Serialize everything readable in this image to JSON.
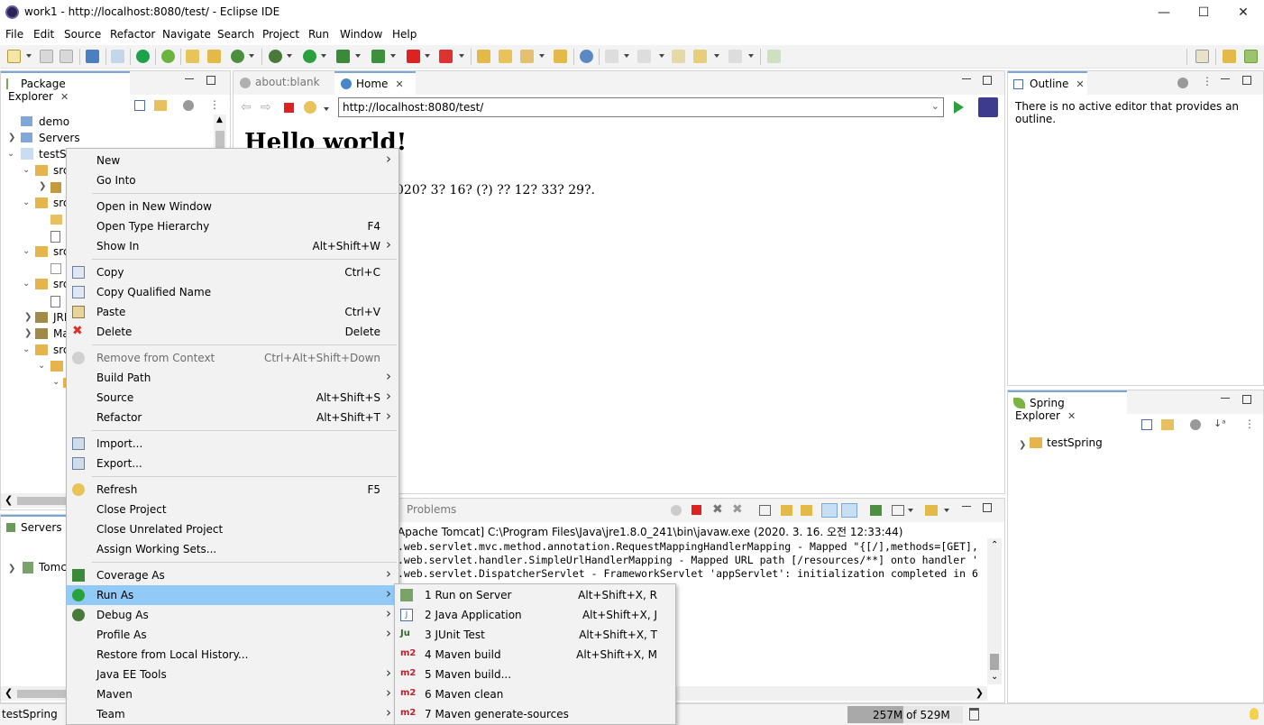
{
  "window": {
    "title": "work1 - http://localhost:8080/test/ - Eclipse IDE",
    "minimize": "—",
    "maximize": "☐",
    "close": "✕"
  },
  "menubar": [
    "File",
    "Edit",
    "Source",
    "Refactor",
    "Navigate",
    "Search",
    "Project",
    "Run",
    "Window",
    "Help"
  ],
  "package_explorer": {
    "tab": "Package Explorer",
    "items": [
      "demo",
      "Servers",
      "testSp",
      "src",
      "src",
      "src",
      "src",
      "JRE",
      "Ma",
      "src"
    ]
  },
  "servers": {
    "tab": "Servers",
    "item": "Tomc"
  },
  "browser": {
    "tab_blank": "about:blank",
    "tab_home": "Home",
    "url": "http://localhost:8080/test/",
    "heading": "Hello world!",
    "text": "020? 3? 16? (?) ?? 12? 33? 29?."
  },
  "outline": {
    "tab": "Outline",
    "message": "There is no active editor that provides an outline."
  },
  "spring_explorer": {
    "tab": "Spring Explorer",
    "item": "testSpring"
  },
  "console": {
    "tab": "Problems",
    "launch": "Apache Tomcat] C:\\Program Files\\Java\\jre1.8.0_241\\bin\\javaw.exe (2020. 3. 16. 오전 12:33:44)",
    "lines": [
      ".web.servlet.mvc.method.annotation.RequestMappingHandlerMapping - Mapped \"{[/],methods=[GET],",
      ".web.servlet.handler.SimpleUrlHandlerMapping - Mapped URL path [/resources/**] onto handler '",
      ".web.servlet.DispatcherServlet - FrameworkServlet 'appServlet': initialization completed in 6"
    ]
  },
  "context_menu": {
    "groups": [
      [
        {
          "label": "New",
          "shortcut": "",
          "submenu": true
        },
        {
          "label": "Go Into",
          "shortcut": "",
          "submenu": false
        }
      ],
      [
        {
          "label": "Open in New Window",
          "shortcut": "",
          "submenu": false
        },
        {
          "label": "Open Type Hierarchy",
          "shortcut": "F4",
          "submenu": false
        },
        {
          "label": "Show In",
          "shortcut": "Alt+Shift+W",
          "submenu": true
        }
      ],
      [
        {
          "label": "Copy",
          "shortcut": "Ctrl+C",
          "submenu": false,
          "icon": "copy-icon"
        },
        {
          "label": "Copy Qualified Name",
          "shortcut": "",
          "submenu": false,
          "icon": "copy-qualified-icon"
        },
        {
          "label": "Paste",
          "shortcut": "Ctrl+V",
          "submenu": false,
          "icon": "paste-icon"
        },
        {
          "label": "Delete",
          "shortcut": "Delete",
          "submenu": false,
          "icon": "delete-icon"
        }
      ],
      [
        {
          "label": "Remove from Context",
          "shortcut": "Ctrl+Alt+Shift+Down",
          "submenu": false,
          "disabled": true,
          "icon": "remove-context-icon"
        },
        {
          "label": "Build Path",
          "shortcut": "",
          "submenu": true
        },
        {
          "label": "Source",
          "shortcut": "Alt+Shift+S",
          "submenu": true
        },
        {
          "label": "Refactor",
          "shortcut": "Alt+Shift+T",
          "submenu": true
        }
      ],
      [
        {
          "label": "Import...",
          "shortcut": "",
          "submenu": false,
          "icon": "import-icon"
        },
        {
          "label": "Export...",
          "shortcut": "",
          "submenu": false,
          "icon": "export-icon"
        }
      ],
      [
        {
          "label": "Refresh",
          "shortcut": "F5",
          "submenu": false,
          "icon": "refresh-icon"
        },
        {
          "label": "Close Project",
          "shortcut": "",
          "submenu": false
        },
        {
          "label": "Close Unrelated Project",
          "shortcut": "",
          "submenu": false
        },
        {
          "label": "Assign Working Sets...",
          "shortcut": "",
          "submenu": false
        }
      ],
      [
        {
          "label": "Coverage As",
          "shortcut": "",
          "submenu": true,
          "icon": "coverage-icon"
        },
        {
          "label": "Run As",
          "shortcut": "",
          "submenu": true,
          "highlighted": true,
          "icon": "run-icon"
        },
        {
          "label": "Debug As",
          "shortcut": "",
          "submenu": true,
          "icon": "debug-icon"
        },
        {
          "label": "Profile As",
          "shortcut": "",
          "submenu": true
        },
        {
          "label": "Restore from Local History...",
          "shortcut": "",
          "submenu": false
        },
        {
          "label": "Java EE Tools",
          "shortcut": "",
          "submenu": true
        },
        {
          "label": "Maven",
          "shortcut": "",
          "submenu": true
        },
        {
          "label": "Team",
          "shortcut": "",
          "submenu": true
        }
      ]
    ]
  },
  "run_as_menu": [
    {
      "label": "1 Run on Server",
      "shortcut": "Alt+Shift+X, R",
      "icon": "server-icon"
    },
    {
      "label": "2 Java Application",
      "shortcut": "Alt+Shift+X, J",
      "icon": "java-app-icon"
    },
    {
      "label": "3 JUnit Test",
      "shortcut": "Alt+Shift+X, T",
      "icon": "junit-icon"
    },
    {
      "label": "4 Maven build",
      "shortcut": "Alt+Shift+X, M",
      "icon": "m2"
    },
    {
      "label": "5 Maven build...",
      "shortcut": "",
      "icon": "m2"
    },
    {
      "label": "6 Maven clean",
      "shortcut": "",
      "icon": "m2"
    },
    {
      "label": "7 Maven generate-sources",
      "shortcut": "",
      "icon": "m2"
    }
  ],
  "statusbar": {
    "selection": "testSpring",
    "memory": "257M of 529M"
  },
  "colors": {
    "menu_highlight": "#91c9f7",
    "tab_active_border": "#79a7d8",
    "m2_red": "#c0202a"
  }
}
